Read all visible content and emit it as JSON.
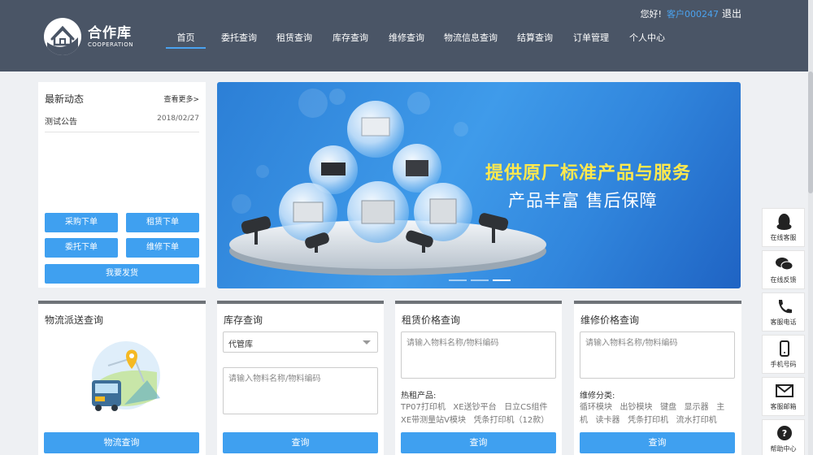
{
  "header": {
    "logo_cn": "合作库",
    "logo_en": "COOPERATION",
    "greeting": "您好!",
    "customer": "客户000247",
    "logout": "退出",
    "nav": [
      {
        "label": "首页"
      },
      {
        "label": "委托查询"
      },
      {
        "label": "租赁查询"
      },
      {
        "label": "库存查询"
      },
      {
        "label": "维修查询"
      },
      {
        "label": "物流信息查询"
      },
      {
        "label": "结算查询"
      },
      {
        "label": "订单管理"
      },
      {
        "label": "个人中心"
      }
    ]
  },
  "news": {
    "title": "最新动态",
    "more": "查看更多>",
    "items": [
      {
        "title": "测试公告",
        "date": "2018/02/27"
      }
    ],
    "buttons": {
      "purchase": "采购下单",
      "rent": "租赁下单",
      "entrust": "委托下单",
      "repair": "维修下单",
      "ship": "我要发货"
    }
  },
  "banner": {
    "line1": "提供原厂标准产品与服务",
    "line2": "产品丰富 售后保障",
    "slides": 3,
    "active_slide": 3
  },
  "cards": {
    "logistics": {
      "title": "物流派送查询",
      "button": "物流查询"
    },
    "inventory": {
      "title": "库存查询",
      "select_value": "代管库",
      "placeholder": "请输入物料名称/物料编码",
      "button": "查询"
    },
    "rent_price": {
      "title": "租赁价格查询",
      "placeholder": "请输入物料名称/物料编码",
      "hot_label": "热租产品:",
      "hot_items": [
        "TP07打印机",
        "XE送钞平台",
        "日立CS组件",
        "XE带测量站V模块",
        "凭条打印机（12款）"
      ],
      "button": "查询"
    },
    "repair_price": {
      "title": "维修价格查询",
      "placeholder": "请输入物料名称/物料编码",
      "category_label": "维修分类:",
      "category_items": [
        "循环模块",
        "出钞模块",
        "键盘",
        "显示器",
        "主机",
        "读卡器",
        "凭条打印机",
        "流水打印机"
      ],
      "button": "查询"
    }
  },
  "float_bar": [
    {
      "label": "在线客服",
      "icon": "qq-icon"
    },
    {
      "label": "在线反馈",
      "icon": "chat-icon"
    },
    {
      "label": "客服电话",
      "icon": "phone-icon"
    },
    {
      "label": "手机号码",
      "icon": "mobile-icon"
    },
    {
      "label": "客服邮箱",
      "icon": "mail-icon"
    },
    {
      "label": "帮助中心",
      "icon": "help-icon"
    }
  ],
  "colors": {
    "header": "#4a5566",
    "accent": "#3fa0f0",
    "banner_yellow": "#ffe94d"
  }
}
